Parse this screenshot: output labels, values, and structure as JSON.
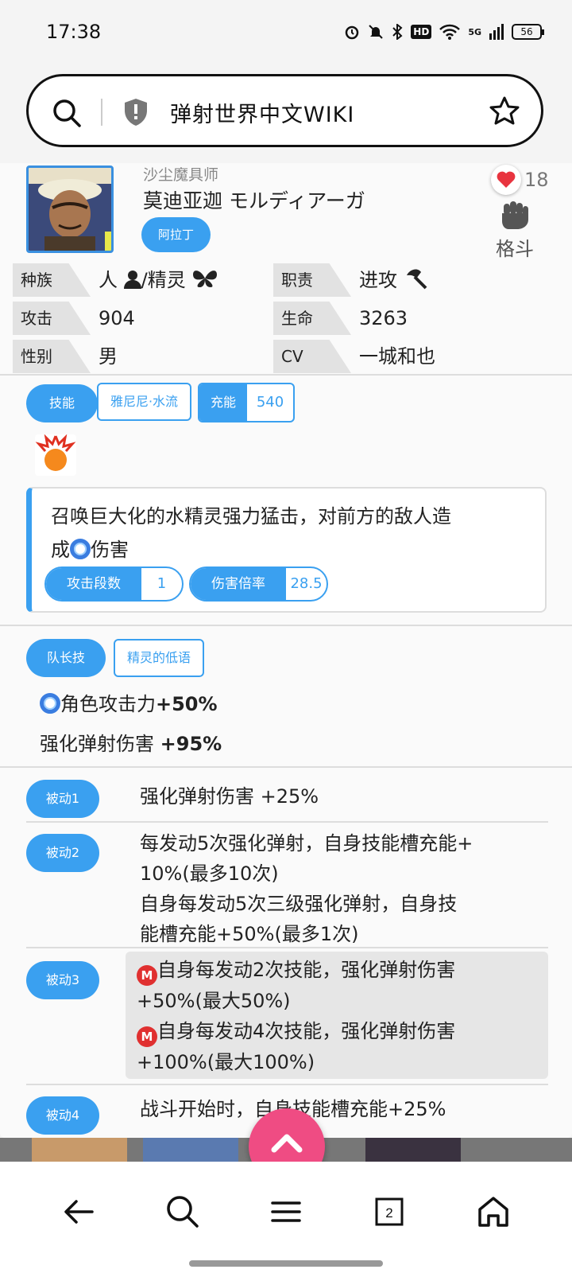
{
  "status_bar": {
    "time": "17:38",
    "hd_label": "HD",
    "network": "5G",
    "battery": "56"
  },
  "search": {
    "title": "弹射世界中文WIKI"
  },
  "character": {
    "subtitle": "沙尘魔具师",
    "name": "莫迪亚迦 モルディアーガ",
    "origin_tag": "阿拉丁",
    "likes": "18",
    "class_label": "格斗"
  },
  "info": [
    {
      "label": "种族",
      "value": "人 ",
      "value2": "/精灵"
    },
    {
      "label": "职责",
      "value": "进攻 "
    },
    {
      "label": "攻击",
      "value": "904"
    },
    {
      "label": "生命",
      "value": "3263"
    },
    {
      "label": "性别",
      "value": "男"
    },
    {
      "label": "CV",
      "value": "一城和也"
    }
  ],
  "skill": {
    "tab_label": "技能",
    "skill_name": "雅尼尼·水流",
    "charge_label": "充能",
    "charge_value": "540",
    "description_1": "召唤巨大化的水精灵强力猛击，对前方的敌人造",
    "description_2a": "成",
    "description_2b": "伤害",
    "hits_label": "攻击段数",
    "hits_value": "1",
    "multiplier_label": "伤害倍率",
    "multiplier_value": "28.5"
  },
  "leader": {
    "tab_label": "队长技",
    "skill_name": "精灵的低语",
    "line1_text": "角色攻击力",
    "line1_value": "+50%",
    "line2_text": "强化弹射伤害",
    "line2_value": "+95%"
  },
  "passives": [
    {
      "label": "被动1",
      "lines": [
        "强化弹射伤害 +25%"
      ]
    },
    {
      "label": "被动2",
      "lines": [
        "每发动5次强化弹射，自身技能槽充能+",
        "10%(最多10次)",
        "自身每发动5次三级强化弹射，自身技",
        "能槽充能+50%(最多1次)"
      ]
    },
    {
      "label": "被动3",
      "lines": [
        "自身每发动2次技能，强化弹射伤害",
        "+50%(最大50%)",
        "自身每发动4次技能，强化弹射伤害",
        "+100%(最大100%)"
      ]
    },
    {
      "label": "被动4",
      "lines": [
        "战斗开始时，自身技能槽充能+25%"
      ]
    }
  ],
  "colors": {
    "accent": "#3aa0f0",
    "fab": "#ef4c83",
    "heart": "#e8343f"
  }
}
